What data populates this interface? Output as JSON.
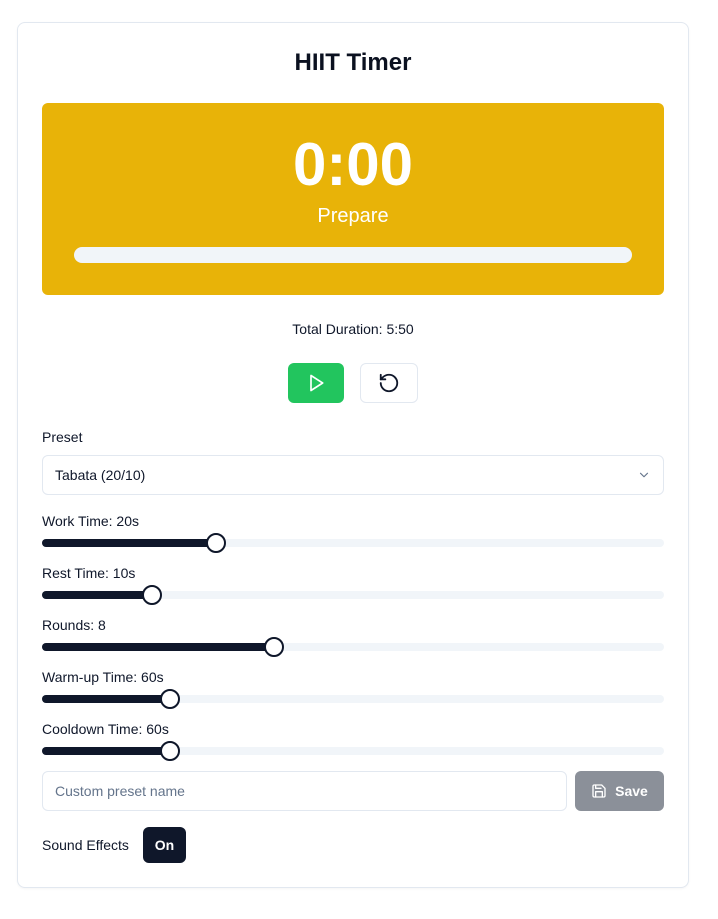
{
  "app": {
    "title": "HIIT Timer"
  },
  "display": {
    "time": "0:00",
    "phase": "Prepare",
    "color": "#e8b308",
    "progress_percent": 0
  },
  "summary": {
    "total_duration": "Total Duration: 5:50"
  },
  "controls": {
    "play_icon": "play-icon",
    "reset_icon": "reset-icon",
    "play_color": "#22c55e"
  },
  "preset": {
    "label": "Preset",
    "selected": "Tabata (20/10)"
  },
  "sliders": [
    {
      "label": "Work Time: 20s",
      "fill_percent": 28
    },
    {
      "label": "Rest Time: 10s",
      "fill_percent": 17.7
    },
    {
      "label": "Rounds: 8",
      "fill_percent": 37.3
    },
    {
      "label": "Warm-up Time: 60s",
      "fill_percent": 20.6
    },
    {
      "label": "Cooldown Time: 60s",
      "fill_percent": 20.6
    }
  ],
  "custom_preset": {
    "placeholder": "Custom preset name",
    "save_label": "Save"
  },
  "sound": {
    "label": "Sound Effects",
    "state": "On"
  }
}
